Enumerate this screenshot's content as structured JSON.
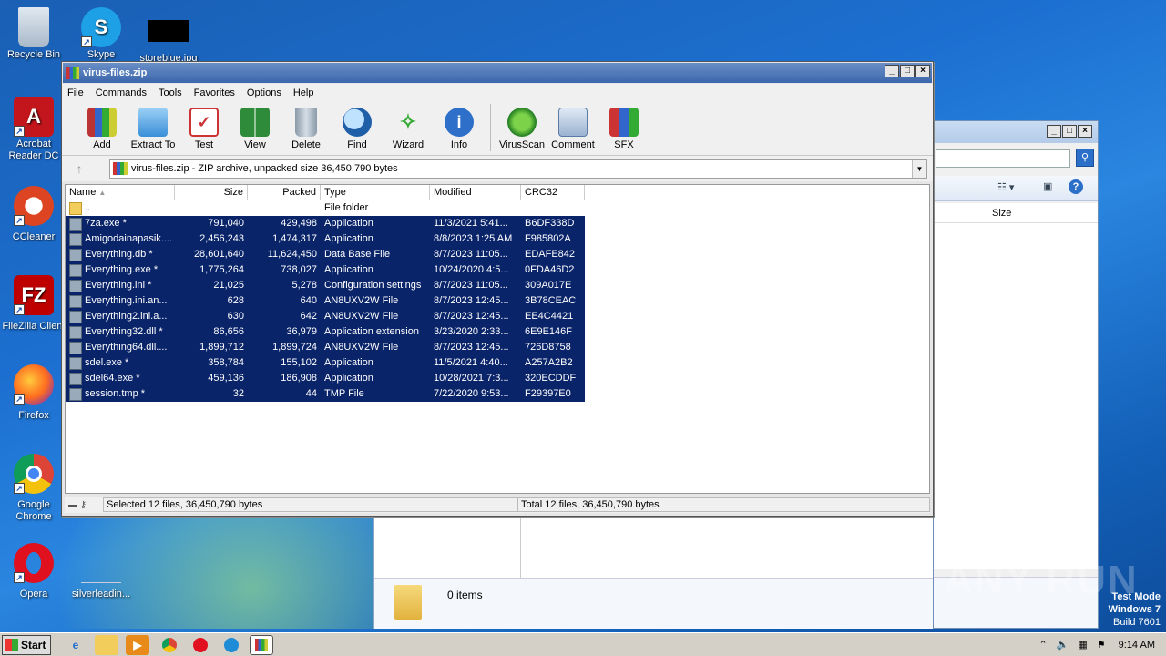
{
  "desktop": {
    "icons": [
      {
        "label": "Recycle Bin",
        "name": "recycle-bin-icon"
      },
      {
        "label": "Skype",
        "name": "skype-icon"
      },
      {
        "label": "storeblue.jpg",
        "name": "image-file-icon"
      },
      {
        "label": "Acrobat Reader DC",
        "name": "acrobat-icon"
      },
      {
        "label": "CCleaner",
        "name": "ccleaner-icon"
      },
      {
        "label": "FileZilla Client",
        "name": "filezilla-icon"
      },
      {
        "label": "Firefox",
        "name": "firefox-icon"
      },
      {
        "label": "Google Chrome",
        "name": "chrome-icon"
      },
      {
        "label": "Opera",
        "name": "opera-icon"
      },
      {
        "label": "silverleadin...",
        "name": "file-icon"
      }
    ],
    "watermark": "ANY RUN",
    "test_mode": {
      "line1": "Test Mode",
      "line2": "Windows 7",
      "line3": "Build 7601"
    }
  },
  "explorer": {
    "size_header": "Size",
    "items_count": "0 items"
  },
  "rar": {
    "title": "virus-files.zip",
    "menu": [
      "File",
      "Commands",
      "Tools",
      "Favorites",
      "Options",
      "Help"
    ],
    "toolbar": [
      "Add",
      "Extract To",
      "Test",
      "View",
      "Delete",
      "Find",
      "Wizard",
      "Info",
      "VirusScan",
      "Comment",
      "SFX"
    ],
    "path": "virus-files.zip - ZIP archive, unpacked size 36,450,790 bytes",
    "columns": [
      "Name",
      "Size",
      "Packed",
      "Type",
      "Modified",
      "CRC32"
    ],
    "parent_row": {
      "name": "..",
      "type": "File folder"
    },
    "files": [
      {
        "name": "7za.exe *",
        "size": "791,040",
        "packed": "429,498",
        "type": "Application",
        "modified": "11/3/2021 5:41...",
        "crc": "B6DF338D"
      },
      {
        "name": "Amigodainapasik....",
        "size": "2,456,243",
        "packed": "1,474,317",
        "type": "Application",
        "modified": "8/8/2023 1:25 AM",
        "crc": "F985802A"
      },
      {
        "name": "Everything.db *",
        "size": "28,601,640",
        "packed": "11,624,450",
        "type": "Data Base File",
        "modified": "8/7/2023 11:05...",
        "crc": "EDAFE842"
      },
      {
        "name": "Everything.exe *",
        "size": "1,775,264",
        "packed": "738,027",
        "type": "Application",
        "modified": "10/24/2020 4:5...",
        "crc": "0FDA46D2"
      },
      {
        "name": "Everything.ini *",
        "size": "21,025",
        "packed": "5,278",
        "type": "Configuration settings",
        "modified": "8/7/2023 11:05...",
        "crc": "309A017E"
      },
      {
        "name": "Everything.ini.an...",
        "size": "628",
        "packed": "640",
        "type": "AN8UXV2W File",
        "modified": "8/7/2023 12:45...",
        "crc": "3B78CEAC"
      },
      {
        "name": "Everything2.ini.a...",
        "size": "630",
        "packed": "642",
        "type": "AN8UXV2W File",
        "modified": "8/7/2023 12:45...",
        "crc": "EE4C4421"
      },
      {
        "name": "Everything32.dll *",
        "size": "86,656",
        "packed": "36,979",
        "type": "Application extension",
        "modified": "3/23/2020 2:33...",
        "crc": "6E9E146F"
      },
      {
        "name": "Everything64.dll....",
        "size": "1,899,712",
        "packed": "1,899,724",
        "type": "AN8UXV2W File",
        "modified": "8/7/2023 12:45...",
        "crc": "726D8758"
      },
      {
        "name": "sdel.exe *",
        "size": "358,784",
        "packed": "155,102",
        "type": "Application",
        "modified": "11/5/2021 4:40...",
        "crc": "A257A2B2"
      },
      {
        "name": "sdel64.exe *",
        "size": "459,136",
        "packed": "186,908",
        "type": "Application",
        "modified": "10/28/2021 7:3...",
        "crc": "320ECDDF"
      },
      {
        "name": "session.tmp *",
        "size": "32",
        "packed": "44",
        "type": "TMP File",
        "modified": "7/22/2020 9:53...",
        "crc": "F29397E0"
      }
    ],
    "status_left": "Selected 12 files, 36,450,790 bytes",
    "status_right": "Total 12 files, 36,450,790 bytes"
  },
  "taskbar": {
    "start_label": "Start",
    "clock": "9:14 AM"
  }
}
